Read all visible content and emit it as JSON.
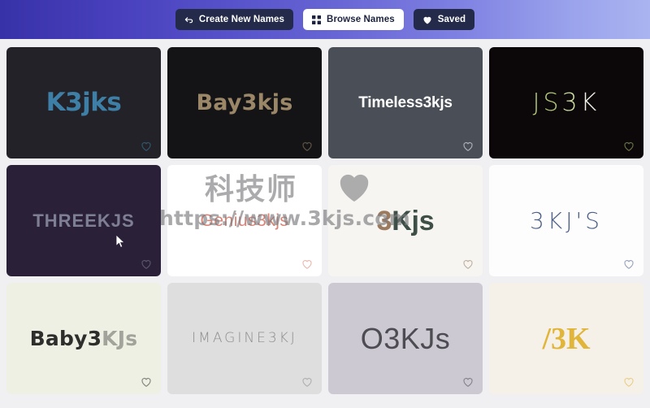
{
  "topbar": {
    "gradient_from": "#3832a8",
    "gradient_to": "#aab4f0",
    "buttons": [
      {
        "label": "Create New Names",
        "icon": "back-arrow-icon",
        "style": "dark"
      },
      {
        "label": "Browse Names",
        "icon": "grid-icon",
        "style": "light"
      },
      {
        "label": "Saved",
        "icon": "heart-filled-icon",
        "style": "dark"
      }
    ]
  },
  "watermark": {
    "brand": "科技师",
    "url": "https://www.3kjs.com",
    "icon": "heart-filled-icon",
    "color": "#78787a"
  },
  "grid": {
    "favorite_icon": "heart-outline-icon",
    "cards": [
      {
        "name": "K3jks",
        "bg": "#232228",
        "segments": [
          {
            "text": "K3jks",
            "color": "#3d7fa6"
          }
        ],
        "style": "t-geo",
        "size": 31
      },
      {
        "name": "Bay3kjs",
        "bg": "#141417",
        "segments": [
          {
            "text": "Bay3kjs",
            "color": "#9b8767"
          }
        ],
        "style": "t-round",
        "size": 27
      },
      {
        "name": "Timeless3kjs",
        "bg": "#4a4e57",
        "segments": [
          {
            "text": "Timeless3kjs",
            "color": "#ffffff"
          }
        ],
        "style": "t-bold",
        "size": 19
      },
      {
        "name": "JS3K",
        "bg": "#0c0709",
        "segments": [
          {
            "text": "JS",
            "color": "#b3c878"
          },
          {
            "text": "3",
            "color": "#cfe0a0"
          },
          {
            "text": "K",
            "color": "#f2f2ea"
          }
        ],
        "style": "t-thin",
        "size": 30
      },
      {
        "name": "THREEKJS",
        "bg": "#2a2139",
        "segments": [
          {
            "text": "THREEKJS",
            "color": "#7e7f95"
          }
        ],
        "style": "t-wide",
        "size": 22
      },
      {
        "name": "Genius3kjs",
        "bg": "#ffffff",
        "segments": [
          {
            "text": "Genius3kjs",
            "color": "#d98477"
          }
        ],
        "style": "t-light",
        "size": 21
      },
      {
        "name": "3Kjs",
        "bg": "#f6f5f2",
        "segments": [
          {
            "text": "3",
            "color": "#9b7a5e"
          },
          {
            "text": "K",
            "color": "#3e4f48"
          },
          {
            "text": "j",
            "color": "#3e4f48"
          },
          {
            "text": "s",
            "color": "#3e4f48"
          }
        ],
        "style": "t-bold",
        "size": 34
      },
      {
        "name": "3KJ'S",
        "bg": "#fdfdfd",
        "segments": [
          {
            "text": "3KJ'S",
            "color": "#4b5f86"
          }
        ],
        "style": "t-thin",
        "size": 28
      },
      {
        "name": "Baby3KJs",
        "bg": "#eef0e4",
        "segments": [
          {
            "text": "Baby3",
            "color": "#2e2e2c"
          },
          {
            "text": "KJs",
            "color": "#a2a49c"
          }
        ],
        "style": "t-round",
        "size": 25
      },
      {
        "name": "IMAGINE3KJ",
        "bg": "#dedede",
        "segments": [
          {
            "text": "IMAGINE3KJ",
            "color": "#8e8e8e"
          }
        ],
        "style": "t-mono",
        "size": 17
      },
      {
        "name": "O3KJs",
        "bg": "#cdc9d2",
        "segments": [
          {
            "text": "O3KJs",
            "color": "#4c4c52"
          }
        ],
        "style": "t-light",
        "size": 36
      },
      {
        "name": "/3K",
        "bg": "#f6f1e8",
        "segments": [
          {
            "text": "/3K",
            "color": "#e0b53a"
          }
        ],
        "style": "t-serif",
        "size": 38
      }
    ]
  }
}
